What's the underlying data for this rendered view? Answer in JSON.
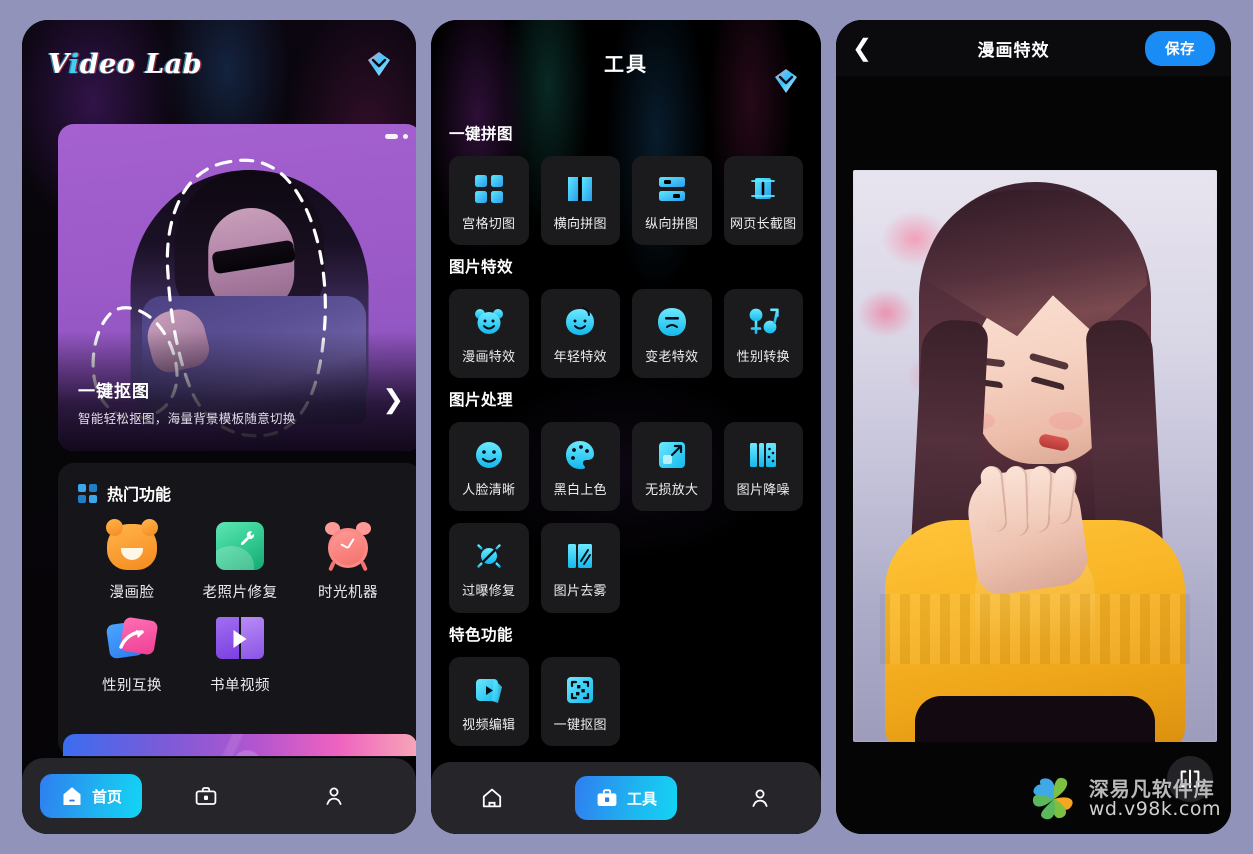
{
  "home": {
    "brand": "Video Lab",
    "brand_accent_char": "i",
    "premium_icon": "diamond-icon",
    "banner": {
      "title": "一键抠图",
      "subtitle": "智能轻松抠图，海量背景模板随意切换",
      "arrow_icon": "chevron-right-icon",
      "menu_icon": "more-dots-icon"
    },
    "hot_section": {
      "icon": "grid-icon",
      "title": "热门功能",
      "items": [
        {
          "label": "漫画脸",
          "icon": "bear-face-icon"
        },
        {
          "label": "老照片修复",
          "icon": "photo-repair-icon"
        },
        {
          "label": "时光机器",
          "icon": "alarm-clock-icon"
        },
        {
          "label": "性别互换",
          "icon": "gender-swap-icon"
        },
        {
          "label": "书单视频",
          "icon": "book-video-icon"
        }
      ]
    },
    "nav": [
      {
        "label": "首页",
        "icon": "home-icon",
        "active": true
      },
      {
        "label": "",
        "icon": "toolbox-icon",
        "active": false
      },
      {
        "label": "",
        "icon": "person-icon",
        "active": false
      }
    ]
  },
  "tools": {
    "title": "工具",
    "premium_icon": "diamond-icon",
    "sections": [
      {
        "title": "一键拼图",
        "items": [
          {
            "label": "宫格切图",
            "icon": "grid-split-icon"
          },
          {
            "label": "横向拼图",
            "icon": "horizontal-stitch-icon"
          },
          {
            "label": "纵向拼图",
            "icon": "vertical-stitch-icon"
          },
          {
            "label": "网页长截图",
            "icon": "webpage-longshot-icon"
          }
        ]
      },
      {
        "title": "图片特效",
        "items": [
          {
            "label": "漫画特效",
            "icon": "bear-face-icon"
          },
          {
            "label": "年轻特效",
            "icon": "young-face-icon"
          },
          {
            "label": "变老特效",
            "icon": "old-face-icon"
          },
          {
            "label": "性别转换",
            "icon": "gender-symbols-icon"
          }
        ]
      },
      {
        "title": "图片处理",
        "items": [
          {
            "label": "人脸清晰",
            "icon": "face-clarity-icon"
          },
          {
            "label": "黑白上色",
            "icon": "palette-icon"
          },
          {
            "label": "无损放大",
            "icon": "upscale-icon"
          },
          {
            "label": "图片降噪",
            "icon": "denoise-icon"
          },
          {
            "label": "过曝修复",
            "icon": "overexposure-icon"
          },
          {
            "label": "图片去雾",
            "icon": "dehaze-icon"
          }
        ]
      },
      {
        "title": "特色功能",
        "items": [
          {
            "label": "视频编辑",
            "icon": "video-edit-icon"
          },
          {
            "label": "一键抠图",
            "icon": "cutout-icon"
          }
        ]
      }
    ],
    "nav": [
      {
        "label": "",
        "icon": "home-icon",
        "active": false
      },
      {
        "label": "工具",
        "icon": "toolbox-icon",
        "active": true
      },
      {
        "label": "",
        "icon": "person-icon",
        "active": false
      }
    ]
  },
  "editor": {
    "back_icon": "chevron-left-icon",
    "title": "漫画特效",
    "save_label": "保存",
    "compare_icon": "compare-split-icon"
  },
  "watermark": {
    "logo_icon": "pinwheel-logo-icon",
    "name": "深易凡软件库",
    "url": "wd.v98k.com"
  },
  "colors": {
    "page_background": "#9293bb",
    "accent_cyan": "#13d4f5",
    "accent_blue": "#2f7ef0",
    "save_blue": "#1a8cf5",
    "card_dark": "#1b1b1e",
    "nav_dark": "#25252a"
  }
}
